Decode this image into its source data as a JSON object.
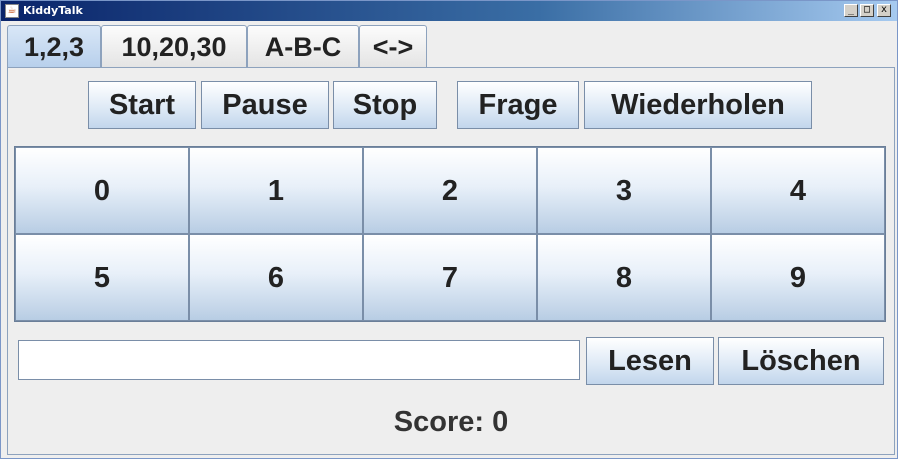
{
  "window": {
    "title": "KiddyTalk",
    "minimize": "_",
    "maximize": "□",
    "close": "x"
  },
  "tabs": [
    {
      "label": "1,2,3",
      "active": true
    },
    {
      "label": "10,20,30",
      "active": false
    },
    {
      "label": "A-B-C",
      "active": false
    },
    {
      "label": "<->",
      "active": false
    }
  ],
  "toolbar": {
    "start": "Start",
    "pause": "Pause",
    "stop": "Stop",
    "question": "Frage",
    "repeat": "Wiederholen"
  },
  "keys": [
    "0",
    "1",
    "2",
    "3",
    "4",
    "5",
    "6",
    "7",
    "8",
    "9"
  ],
  "input": {
    "value": ""
  },
  "actions": {
    "read": "Lesen",
    "clear": "Löschen"
  },
  "score": {
    "label": "Score:",
    "value": "0"
  }
}
